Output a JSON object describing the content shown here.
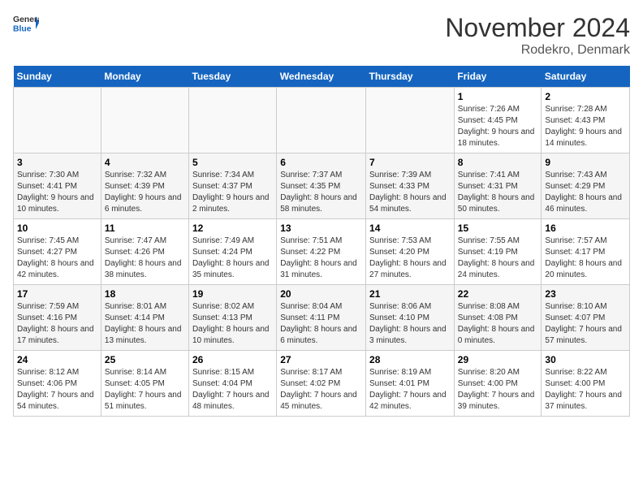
{
  "header": {
    "logo_general": "General",
    "logo_blue": "Blue",
    "month_title": "November 2024",
    "location": "Rodekro, Denmark"
  },
  "weekdays": [
    "Sunday",
    "Monday",
    "Tuesday",
    "Wednesday",
    "Thursday",
    "Friday",
    "Saturday"
  ],
  "weeks": [
    [
      {
        "day": "",
        "info": ""
      },
      {
        "day": "",
        "info": ""
      },
      {
        "day": "",
        "info": ""
      },
      {
        "day": "",
        "info": ""
      },
      {
        "day": "",
        "info": ""
      },
      {
        "day": "1",
        "info": "Sunrise: 7:26 AM\nSunset: 4:45 PM\nDaylight: 9 hours and 18 minutes."
      },
      {
        "day": "2",
        "info": "Sunrise: 7:28 AM\nSunset: 4:43 PM\nDaylight: 9 hours and 14 minutes."
      }
    ],
    [
      {
        "day": "3",
        "info": "Sunrise: 7:30 AM\nSunset: 4:41 PM\nDaylight: 9 hours and 10 minutes."
      },
      {
        "day": "4",
        "info": "Sunrise: 7:32 AM\nSunset: 4:39 PM\nDaylight: 9 hours and 6 minutes."
      },
      {
        "day": "5",
        "info": "Sunrise: 7:34 AM\nSunset: 4:37 PM\nDaylight: 9 hours and 2 minutes."
      },
      {
        "day": "6",
        "info": "Sunrise: 7:37 AM\nSunset: 4:35 PM\nDaylight: 8 hours and 58 minutes."
      },
      {
        "day": "7",
        "info": "Sunrise: 7:39 AM\nSunset: 4:33 PM\nDaylight: 8 hours and 54 minutes."
      },
      {
        "day": "8",
        "info": "Sunrise: 7:41 AM\nSunset: 4:31 PM\nDaylight: 8 hours and 50 minutes."
      },
      {
        "day": "9",
        "info": "Sunrise: 7:43 AM\nSunset: 4:29 PM\nDaylight: 8 hours and 46 minutes."
      }
    ],
    [
      {
        "day": "10",
        "info": "Sunrise: 7:45 AM\nSunset: 4:27 PM\nDaylight: 8 hours and 42 minutes."
      },
      {
        "day": "11",
        "info": "Sunrise: 7:47 AM\nSunset: 4:26 PM\nDaylight: 8 hours and 38 minutes."
      },
      {
        "day": "12",
        "info": "Sunrise: 7:49 AM\nSunset: 4:24 PM\nDaylight: 8 hours and 35 minutes."
      },
      {
        "day": "13",
        "info": "Sunrise: 7:51 AM\nSunset: 4:22 PM\nDaylight: 8 hours and 31 minutes."
      },
      {
        "day": "14",
        "info": "Sunrise: 7:53 AM\nSunset: 4:20 PM\nDaylight: 8 hours and 27 minutes."
      },
      {
        "day": "15",
        "info": "Sunrise: 7:55 AM\nSunset: 4:19 PM\nDaylight: 8 hours and 24 minutes."
      },
      {
        "day": "16",
        "info": "Sunrise: 7:57 AM\nSunset: 4:17 PM\nDaylight: 8 hours and 20 minutes."
      }
    ],
    [
      {
        "day": "17",
        "info": "Sunrise: 7:59 AM\nSunset: 4:16 PM\nDaylight: 8 hours and 17 minutes."
      },
      {
        "day": "18",
        "info": "Sunrise: 8:01 AM\nSunset: 4:14 PM\nDaylight: 8 hours and 13 minutes."
      },
      {
        "day": "19",
        "info": "Sunrise: 8:02 AM\nSunset: 4:13 PM\nDaylight: 8 hours and 10 minutes."
      },
      {
        "day": "20",
        "info": "Sunrise: 8:04 AM\nSunset: 4:11 PM\nDaylight: 8 hours and 6 minutes."
      },
      {
        "day": "21",
        "info": "Sunrise: 8:06 AM\nSunset: 4:10 PM\nDaylight: 8 hours and 3 minutes."
      },
      {
        "day": "22",
        "info": "Sunrise: 8:08 AM\nSunset: 4:08 PM\nDaylight: 8 hours and 0 minutes."
      },
      {
        "day": "23",
        "info": "Sunrise: 8:10 AM\nSunset: 4:07 PM\nDaylight: 7 hours and 57 minutes."
      }
    ],
    [
      {
        "day": "24",
        "info": "Sunrise: 8:12 AM\nSunset: 4:06 PM\nDaylight: 7 hours and 54 minutes."
      },
      {
        "day": "25",
        "info": "Sunrise: 8:14 AM\nSunset: 4:05 PM\nDaylight: 7 hours and 51 minutes."
      },
      {
        "day": "26",
        "info": "Sunrise: 8:15 AM\nSunset: 4:04 PM\nDaylight: 7 hours and 48 minutes."
      },
      {
        "day": "27",
        "info": "Sunrise: 8:17 AM\nSunset: 4:02 PM\nDaylight: 7 hours and 45 minutes."
      },
      {
        "day": "28",
        "info": "Sunrise: 8:19 AM\nSunset: 4:01 PM\nDaylight: 7 hours and 42 minutes."
      },
      {
        "day": "29",
        "info": "Sunrise: 8:20 AM\nSunset: 4:00 PM\nDaylight: 7 hours and 39 minutes."
      },
      {
        "day": "30",
        "info": "Sunrise: 8:22 AM\nSunset: 4:00 PM\nDaylight: 7 hours and 37 minutes."
      }
    ]
  ]
}
